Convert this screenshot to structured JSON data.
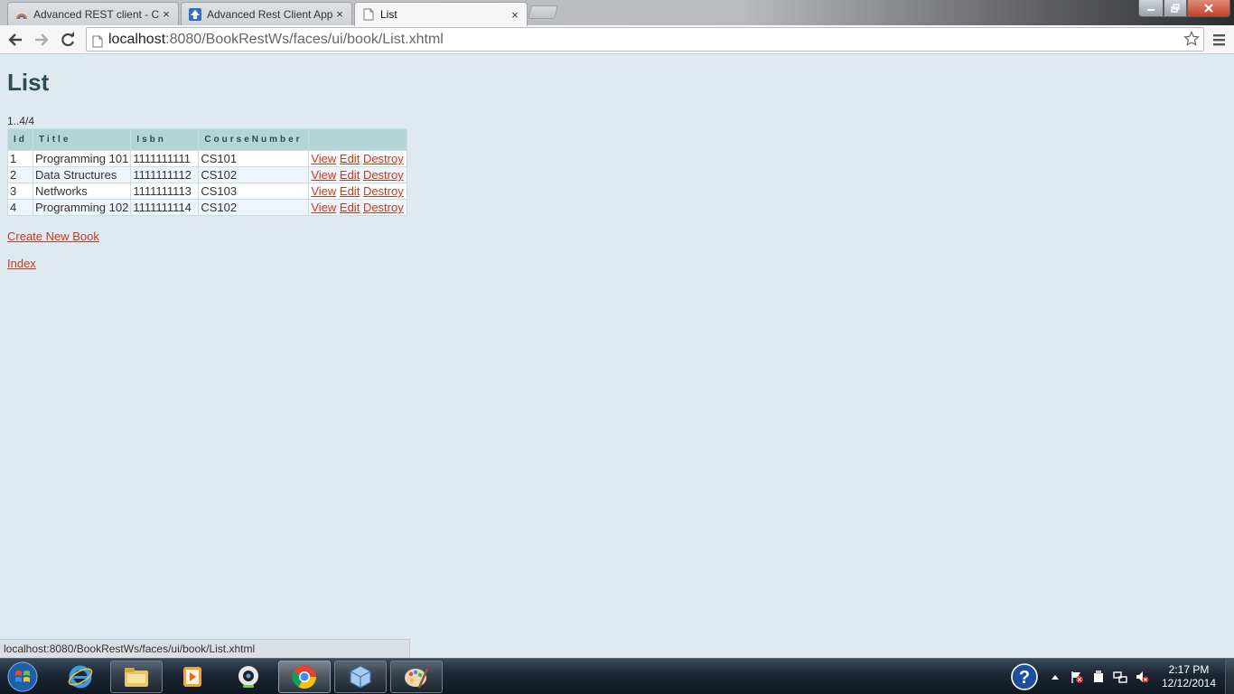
{
  "browser": {
    "tabs": [
      {
        "label": "Advanced REST client - Ch",
        "icon": "rest-client-icon"
      },
      {
        "label": "Advanced Rest Client App",
        "icon": "up-arrow-app-icon"
      },
      {
        "label": "List",
        "icon": "page-icon",
        "active": true
      }
    ],
    "close_glyph": "×",
    "url_host": "localhost",
    "url_rest": ":8080/BookRestWs/faces/ui/book/List.xhtml",
    "status_url": "localhost:8080/BookRestWs/faces/ui/book/List.xhtml"
  },
  "page": {
    "title": "List",
    "range": "1..4/4",
    "columns": [
      "Id",
      "Title",
      "Isbn",
      "CourseNumber",
      ""
    ],
    "rows": [
      {
        "id": "1",
        "title": "Programming 101",
        "isbn": "1111111111",
        "course": "CS101"
      },
      {
        "id": "2",
        "title": "Data Structures",
        "isbn": "1111111112",
        "course": "CS102"
      },
      {
        "id": "3",
        "title": "Netfworks",
        "isbn": "1111111113",
        "course": "CS103"
      },
      {
        "id": "4",
        "title": "Programming 102",
        "isbn": "1111111114",
        "course": "CS102"
      }
    ],
    "actions": {
      "view": "View",
      "edit": "Edit",
      "destroy": "Destroy"
    },
    "create_link": "Create New Book",
    "index_link": "Index"
  },
  "taskbar": {
    "apps": [
      "internet-explorer-icon",
      "file-explorer-icon",
      "media-player-icon",
      "webcam-icon",
      "chrome-icon",
      "virtualbox-icon",
      "paint-icon"
    ],
    "clock_time": "2:17 PM",
    "clock_date": "12/12/2014"
  },
  "colors": {
    "link": "#c4391c",
    "header_bg": "#b4d5d5",
    "page_bg": "#dfeaf0",
    "title": "#2f4b55"
  }
}
